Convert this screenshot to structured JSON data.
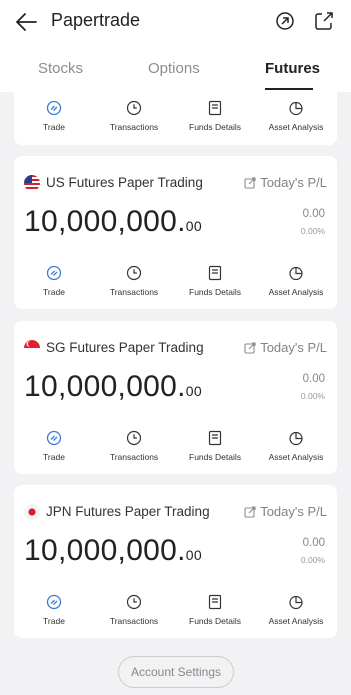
{
  "header": {
    "title": "Papertrade",
    "back_icon": "arrow-left-icon",
    "refresh_icon": "refresh-icon",
    "share_icon": "share-icon"
  },
  "tabs": [
    {
      "label": "Stocks",
      "active": false
    },
    {
      "label": "Options",
      "active": false
    },
    {
      "label": "Futures",
      "active": true
    }
  ],
  "actions": {
    "trade": "Trade",
    "transactions": "Transactions",
    "funds": "Funds Details",
    "asset": "Asset Analysis"
  },
  "accounts": [
    {
      "name": "US Futures Paper Trading",
      "flag": "us-flag-icon",
      "pl_label": "Today's P/L",
      "amount_int": "10,000,000.",
      "amount_dec": "00",
      "pl_value": "0.00",
      "pl_pct": "0.00%"
    },
    {
      "name": "SG Futures Paper Trading",
      "flag": "sg-flag-icon",
      "pl_label": "Today's P/L",
      "amount_int": "10,000,000.",
      "amount_dec": "00",
      "pl_value": "0.00",
      "pl_pct": "0.00%"
    },
    {
      "name": "JPN Futures Paper Trading",
      "flag": "jp-flag-icon",
      "pl_label": "Today's P/L",
      "amount_int": "10,000,000.",
      "amount_dec": "00",
      "pl_value": "0.00",
      "pl_pct": "0.00%"
    }
  ],
  "settings_label": "Account Settings",
  "colors": {
    "accent": "#3a7bd5",
    "text": "#222222",
    "muted": "#888888",
    "background": "#f2f2f4"
  }
}
